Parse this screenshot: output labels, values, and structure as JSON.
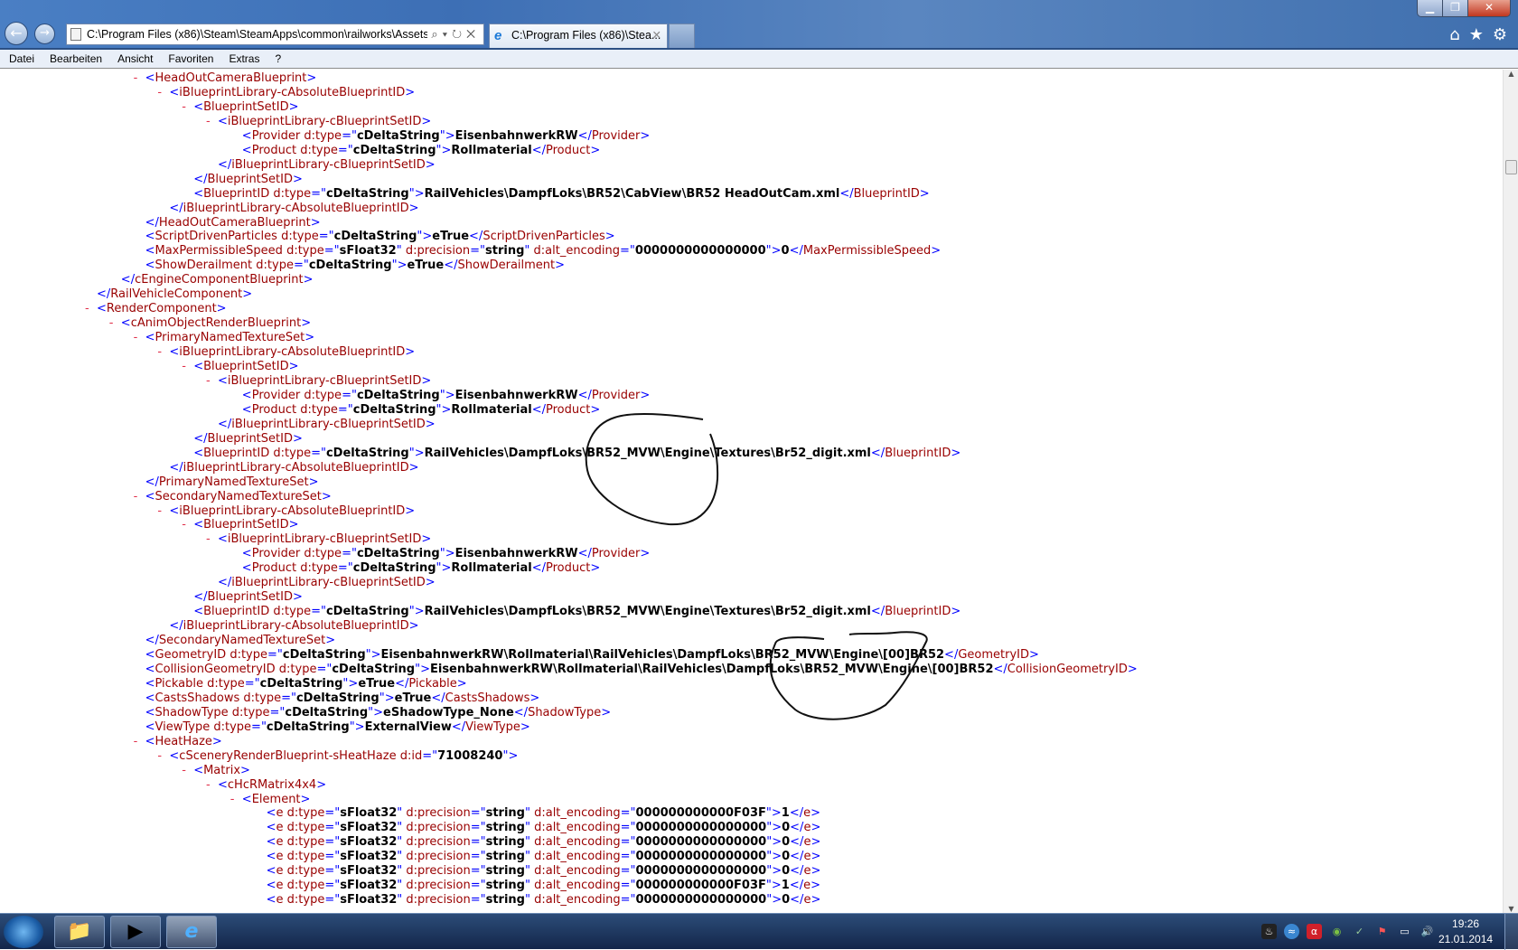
{
  "window": {
    "address": "C:\\Program Files (x86)\\Steam\\SteamApps\\common\\railworks\\Assets\\I",
    "tab_title": "C:\\Program Files (x86)\\Stea...",
    "address_controls": "⌕▾↻✕"
  },
  "menu": [
    "Datei",
    "Bearbeiten",
    "Ansicht",
    "Favoriten",
    "Extras",
    "?"
  ],
  "xml_lines": [
    {
      "l": 2,
      "m": true,
      "t": "HeadOutCameraBlueprint"
    },
    {
      "l": 3,
      "m": true,
      "t": "iBlueprintLibrary-cAbsoluteBlueprintID"
    },
    {
      "l": 4,
      "m": true,
      "t": "BlueprintSetID"
    },
    {
      "l": 5,
      "m": true,
      "t": "iBlueprintLibrary-cBlueprintSetID"
    },
    {
      "l": 6,
      "t": "Provider",
      "a": [
        [
          "d:type",
          "cDeltaString"
        ]
      ],
      "v": "EisenbahnwerkRW",
      "c": "Provider"
    },
    {
      "l": 6,
      "t": "Product",
      "a": [
        [
          "d:type",
          "cDeltaString"
        ]
      ],
      "v": "Rollmaterial",
      "c": "Product"
    },
    {
      "l": 5,
      "c": "iBlueprintLibrary-cBlueprintSetID"
    },
    {
      "l": 4,
      "c": "BlueprintSetID"
    },
    {
      "l": 4,
      "t": "BlueprintID",
      "a": [
        [
          "d:type",
          "cDeltaString"
        ]
      ],
      "v": "RailVehicles\\DampfLoks\\BR52\\CabView\\BR52 HeadOutCam.xml",
      "c": "BlueprintID"
    },
    {
      "l": 3,
      "c": "iBlueprintLibrary-cAbsoluteBlueprintID"
    },
    {
      "l": 2,
      "c": "HeadOutCameraBlueprint"
    },
    {
      "l": 2,
      "t": "ScriptDrivenParticles",
      "a": [
        [
          "d:type",
          "cDeltaString"
        ]
      ],
      "v": "eTrue",
      "c": "ScriptDrivenParticles"
    },
    {
      "l": 2,
      "t": "MaxPermissibleSpeed",
      "a": [
        [
          "d:type",
          "sFloat32"
        ],
        [
          "d:precision",
          "string"
        ],
        [
          "d:alt_encoding",
          "0000000000000000"
        ]
      ],
      "v": "0",
      "c": "MaxPermissibleSpeed"
    },
    {
      "l": 2,
      "t": "ShowDerailment",
      "a": [
        [
          "d:type",
          "cDeltaString"
        ]
      ],
      "v": "eTrue",
      "c": "ShowDerailment"
    },
    {
      "l": 1,
      "c": "cEngineComponentBlueprint"
    },
    {
      "l": 0,
      "c": "RailVehicleComponent"
    },
    {
      "l": 0,
      "m": true,
      "t": "RenderComponent"
    },
    {
      "l": 1,
      "m": true,
      "t": "cAnimObjectRenderBlueprint"
    },
    {
      "l": 2,
      "m": true,
      "t": "PrimaryNamedTextureSet"
    },
    {
      "l": 3,
      "m": true,
      "t": "iBlueprintLibrary-cAbsoluteBlueprintID"
    },
    {
      "l": 4,
      "m": true,
      "t": "BlueprintSetID"
    },
    {
      "l": 5,
      "m": true,
      "t": "iBlueprintLibrary-cBlueprintSetID"
    },
    {
      "l": 6,
      "t": "Provider",
      "a": [
        [
          "d:type",
          "cDeltaString"
        ]
      ],
      "v": "EisenbahnwerkRW",
      "c": "Provider"
    },
    {
      "l": 6,
      "t": "Product",
      "a": [
        [
          "d:type",
          "cDeltaString"
        ]
      ],
      "v": "Rollmaterial",
      "c": "Product"
    },
    {
      "l": 5,
      "c": "iBlueprintLibrary-cBlueprintSetID"
    },
    {
      "l": 4,
      "c": "BlueprintSetID"
    },
    {
      "l": 4,
      "t": "BlueprintID",
      "a": [
        [
          "d:type",
          "cDeltaString"
        ]
      ],
      "v": "RailVehicles\\DampfLoks\\BR52_MVW\\Engine\\Textures\\Br52_digit.xml",
      "c": "BlueprintID"
    },
    {
      "l": 3,
      "c": "iBlueprintLibrary-cAbsoluteBlueprintID"
    },
    {
      "l": 2,
      "c": "PrimaryNamedTextureSet"
    },
    {
      "l": 2,
      "m": true,
      "t": "SecondaryNamedTextureSet"
    },
    {
      "l": 3,
      "m": true,
      "t": "iBlueprintLibrary-cAbsoluteBlueprintID"
    },
    {
      "l": 4,
      "m": true,
      "t": "BlueprintSetID"
    },
    {
      "l": 5,
      "m": true,
      "t": "iBlueprintLibrary-cBlueprintSetID"
    },
    {
      "l": 6,
      "t": "Provider",
      "a": [
        [
          "d:type",
          "cDeltaString"
        ]
      ],
      "v": "EisenbahnwerkRW",
      "c": "Provider"
    },
    {
      "l": 6,
      "t": "Product",
      "a": [
        [
          "d:type",
          "cDeltaString"
        ]
      ],
      "v": "Rollmaterial",
      "c": "Product"
    },
    {
      "l": 5,
      "c": "iBlueprintLibrary-cBlueprintSetID"
    },
    {
      "l": 4,
      "c": "BlueprintSetID"
    },
    {
      "l": 4,
      "t": "BlueprintID",
      "a": [
        [
          "d:type",
          "cDeltaString"
        ]
      ],
      "v": "RailVehicles\\DampfLoks\\BR52_MVW\\Engine\\Textures\\Br52_digit.xml",
      "c": "BlueprintID"
    },
    {
      "l": 3,
      "c": "iBlueprintLibrary-cAbsoluteBlueprintID"
    },
    {
      "l": 2,
      "c": "SecondaryNamedTextureSet"
    },
    {
      "l": 2,
      "t": "GeometryID",
      "a": [
        [
          "d:type",
          "cDeltaString"
        ]
      ],
      "v": "EisenbahnwerkRW\\Rollmaterial\\RailVehicles\\DampfLoks\\BR52_MVW\\Engine\\[00]BR52",
      "c": "GeometryID"
    },
    {
      "l": 2,
      "t": "CollisionGeometryID",
      "a": [
        [
          "d:type",
          "cDeltaString"
        ]
      ],
      "v": "EisenbahnwerkRW\\Rollmaterial\\RailVehicles\\DampfLoks\\BR52_MVW\\Engine\\[00]BR52",
      "c": "CollisionGeometryID"
    },
    {
      "l": 2,
      "t": "Pickable",
      "a": [
        [
          "d:type",
          "cDeltaString"
        ]
      ],
      "v": "eTrue",
      "c": "Pickable"
    },
    {
      "l": 2,
      "t": "CastsShadows",
      "a": [
        [
          "d:type",
          "cDeltaString"
        ]
      ],
      "v": "eTrue",
      "c": "CastsShadows"
    },
    {
      "l": 2,
      "t": "ShadowType",
      "a": [
        [
          "d:type",
          "cDeltaString"
        ]
      ],
      "v": "eShadowType_None",
      "c": "ShadowType"
    },
    {
      "l": 2,
      "t": "ViewType",
      "a": [
        [
          "d:type",
          "cDeltaString"
        ]
      ],
      "v": "ExternalView",
      "c": "ViewType"
    },
    {
      "l": 2,
      "m": true,
      "t": "HeatHaze"
    },
    {
      "l": 3,
      "m": true,
      "t": "cSceneryRenderBlueprint-sHeatHaze",
      "a": [
        [
          "d:id",
          "71008240"
        ]
      ]
    },
    {
      "l": 4,
      "m": true,
      "t": "Matrix"
    },
    {
      "l": 5,
      "m": true,
      "t": "cHcRMatrix4x4"
    },
    {
      "l": 6,
      "m": true,
      "t": "Element"
    },
    {
      "l": 7,
      "t": "e",
      "a": [
        [
          "d:type",
          "sFloat32"
        ],
        [
          "d:precision",
          "string"
        ],
        [
          "d:alt_encoding",
          "000000000000F03F"
        ]
      ],
      "v": "1",
      "c": "e"
    },
    {
      "l": 7,
      "t": "e",
      "a": [
        [
          "d:type",
          "sFloat32"
        ],
        [
          "d:precision",
          "string"
        ],
        [
          "d:alt_encoding",
          "0000000000000000"
        ]
      ],
      "v": "0",
      "c": "e"
    },
    {
      "l": 7,
      "t": "e",
      "a": [
        [
          "d:type",
          "sFloat32"
        ],
        [
          "d:precision",
          "string"
        ],
        [
          "d:alt_encoding",
          "0000000000000000"
        ]
      ],
      "v": "0",
      "c": "e"
    },
    {
      "l": 7,
      "t": "e",
      "a": [
        [
          "d:type",
          "sFloat32"
        ],
        [
          "d:precision",
          "string"
        ],
        [
          "d:alt_encoding",
          "0000000000000000"
        ]
      ],
      "v": "0",
      "c": "e"
    },
    {
      "l": 7,
      "t": "e",
      "a": [
        [
          "d:type",
          "sFloat32"
        ],
        [
          "d:precision",
          "string"
        ],
        [
          "d:alt_encoding",
          "0000000000000000"
        ]
      ],
      "v": "0",
      "c": "e"
    },
    {
      "l": 7,
      "t": "e",
      "a": [
        [
          "d:type",
          "sFloat32"
        ],
        [
          "d:precision",
          "string"
        ],
        [
          "d:alt_encoding",
          "000000000000F03F"
        ]
      ],
      "v": "1",
      "c": "e"
    },
    {
      "l": 7,
      "t": "e",
      "a": [
        [
          "d:type",
          "sFloat32"
        ],
        [
          "d:precision",
          "string"
        ],
        [
          "d:alt_encoding",
          "0000000000000000"
        ]
      ],
      "v": "0",
      "c": "e"
    }
  ],
  "taskbar": {
    "clock_time": "19:26",
    "clock_date": "21.01.2014"
  }
}
